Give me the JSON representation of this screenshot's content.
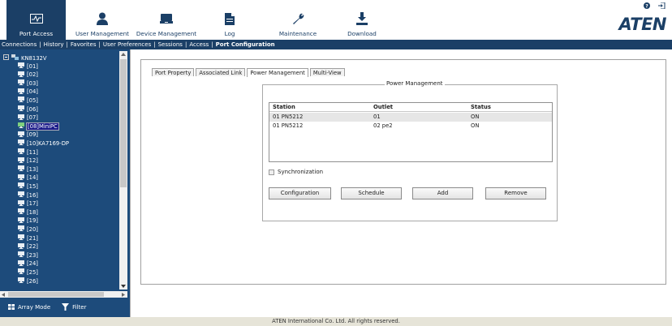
{
  "nav": {
    "items": [
      {
        "label": "Port Access",
        "icon": "port-access-icon",
        "active": true
      },
      {
        "label": "User Management",
        "icon": "user-icon",
        "active": false
      },
      {
        "label": "Device Management",
        "icon": "device-icon",
        "active": false
      },
      {
        "label": "Log",
        "icon": "log-icon",
        "active": false
      },
      {
        "label": "Maintenance",
        "icon": "wrench-icon",
        "active": false
      },
      {
        "label": "Download",
        "icon": "download-icon",
        "active": false
      }
    ],
    "brand": "ATEN",
    "help_icon": "help-icon",
    "logout_icon": "logout-icon"
  },
  "subnav": {
    "items": [
      "Connections",
      "History",
      "Favorites",
      "User Preferences",
      "Sessions",
      "Access",
      "Port Configuration"
    ]
  },
  "sidebar": {
    "root": "KN8132V",
    "ports": [
      "[01]",
      "[02]",
      "[03]",
      "[04]",
      "[05]",
      "[06]",
      "[07]",
      "[08]MiniPC",
      "[09]",
      "[10]KA7169-DP",
      "[11]",
      "[12]",
      "[13]",
      "[14]",
      "[15]",
      "[16]",
      "[17]",
      "[18]",
      "[19]",
      "[20]",
      "[21]",
      "[22]",
      "[23]",
      "[24]",
      "[25]",
      "[26]"
    ],
    "selected_index": 7,
    "array_mode": "Array Mode",
    "filter": "Filter"
  },
  "tabs": [
    "Port Property",
    "Associated Link",
    "Power Management",
    "Multi-View"
  ],
  "active_tab": "Power Management",
  "power": {
    "legend": "Power Management",
    "columns": [
      "Station",
      "Outlet",
      "Status"
    ],
    "rows": [
      [
        "01 PN5212",
        "01",
        "ON"
      ],
      [
        "01 PN5212",
        "02 pe2",
        "ON"
      ]
    ],
    "sync_label": "Synchronization",
    "buttons": {
      "configuration": "Configuration",
      "schedule": "Schedule",
      "add": "Add",
      "remove": "Remove"
    }
  },
  "colors": {
    "navy": "#1b3f66",
    "sidebar": "#1d4b7b"
  },
  "footer": "ATEN International Co. Ltd. All rights reserved."
}
